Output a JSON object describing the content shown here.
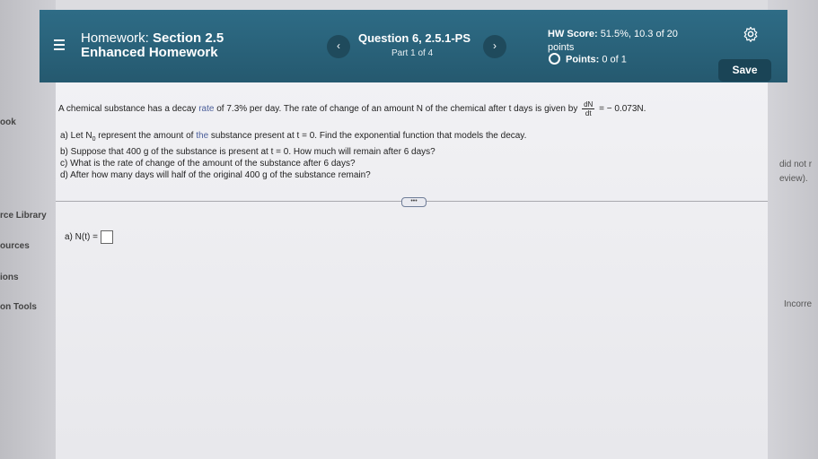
{
  "sidebar": {
    "items": [
      {
        "label": "ook"
      },
      {
        "label": "rce Library"
      },
      {
        "label": "ources"
      },
      {
        "label": "ions"
      },
      {
        "label": "on Tools"
      }
    ]
  },
  "right_panel": {
    "lines": [
      "did not r",
      "eview).",
      "Incorre"
    ]
  },
  "header": {
    "title_prefix": "Homework: ",
    "title_name": "Section 2.5",
    "subtitle": "Enhanced Homework",
    "prev_label": "‹",
    "next_label": "›",
    "question_title": "Question 6, 2.5.1-PS",
    "question_part": "Part 1 of 4",
    "score_label": "HW Score:",
    "score_value": "51.5%, 10.3 of 20",
    "score_unit": "points",
    "points_label": "Points:",
    "points_value": "0 of 1",
    "save_label": "Save"
  },
  "problem": {
    "intro_1": "A chemical substance has a decay",
    "intro_rate_word": "rate",
    "intro_2": "of 7.3% per day. The rate of change of an amount N of the chemical after t days is given by",
    "frac_num": "dN",
    "frac_den": "dt",
    "intro_3": "= − 0.073N.",
    "part_a_1": "a) Let N",
    "part_a_sub": "0",
    "part_a_2": "represent the amount of",
    "part_a_hl": "the",
    "part_a_3": "substance present at t = 0. Find the exponential function that models the decay.",
    "part_b": "b) Suppose that 400 g of the substance is present at t = 0. How much will remain after 6 days?",
    "part_c": "c) What is the rate of change of the amount of the substance after 6 days?",
    "part_d": "d) After how many days will half of the original 400 g of the substance remain?",
    "more_label": "•••",
    "answer_label": "a) N(t) ="
  },
  "colors": {
    "header_bg": "#2a6680",
    "save_bg": "#1a4456",
    "content_bg": "#eeeef1"
  }
}
